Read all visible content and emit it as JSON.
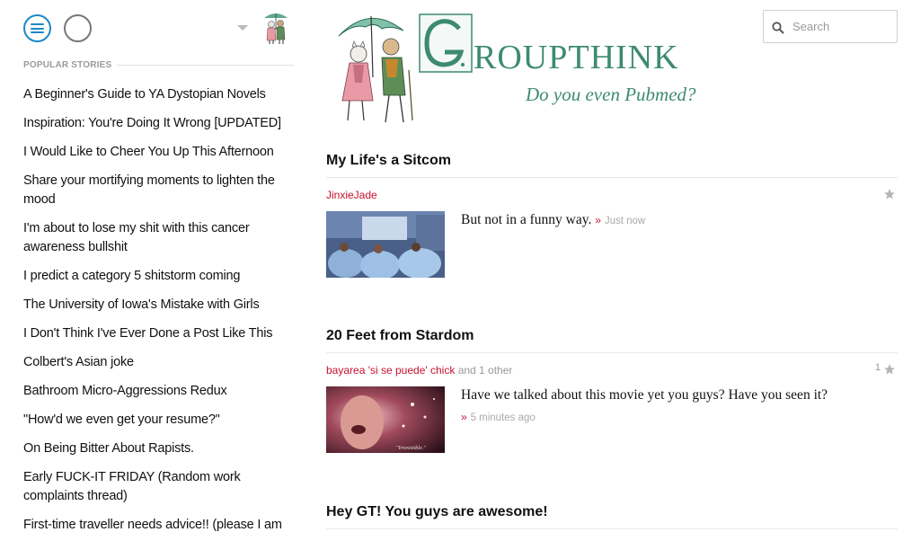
{
  "header": {
    "search_placeholder": "Search"
  },
  "banner": {
    "title": "GROUPTHINK",
    "tagline": "Do you even Pubmed?"
  },
  "sidebar": {
    "section_label": "POPULAR STORIES",
    "stories": [
      "A Beginner's Guide to YA Dystopian Novels",
      "Inspiration: You're Doing It Wrong [UPDATED]",
      "I Would Like to Cheer You Up This Afternoon",
      "Share your mortifying moments to lighten the mood",
      "I'm about to lose my shit with this cancer awareness bullshit",
      "I predict a category 5 shitstorm coming",
      "The University of Iowa's Mistake with Girls",
      "I Don't Think I've Ever Done a Post Like This",
      "Colbert's Asian joke",
      "Bathroom Micro-Aggressions Redux",
      "\"How'd we even get your resume?\"",
      "On Being Bitter About Rapists.",
      "Early FUCK-IT FRIDAY (Random work complaints thread)",
      "First-time traveller needs advice!! (please I am"
    ]
  },
  "posts": [
    {
      "title": "My Life's a Sitcom",
      "author": "JinxieJade",
      "others": "",
      "star_count": "",
      "excerpt": "But not in a funny way.",
      "raquo": "»",
      "time": "Just now"
    },
    {
      "title": "20 Feet from Stardom",
      "author": "bayarea 'si se puede' chick",
      "others": "and 1 other",
      "star_count": "1",
      "excerpt": "Have we talked about this movie yet you guys? Have you seen it?",
      "raquo": "»",
      "time": "5 minutes ago",
      "thumb_caption": "\"Irresistible.\""
    },
    {
      "title": "Hey GT! You guys are awesome!"
    }
  ],
  "colors": {
    "accent_blue": "#1e88c8",
    "author_red": "#c8102e",
    "banner_green": "#3d8a72"
  }
}
